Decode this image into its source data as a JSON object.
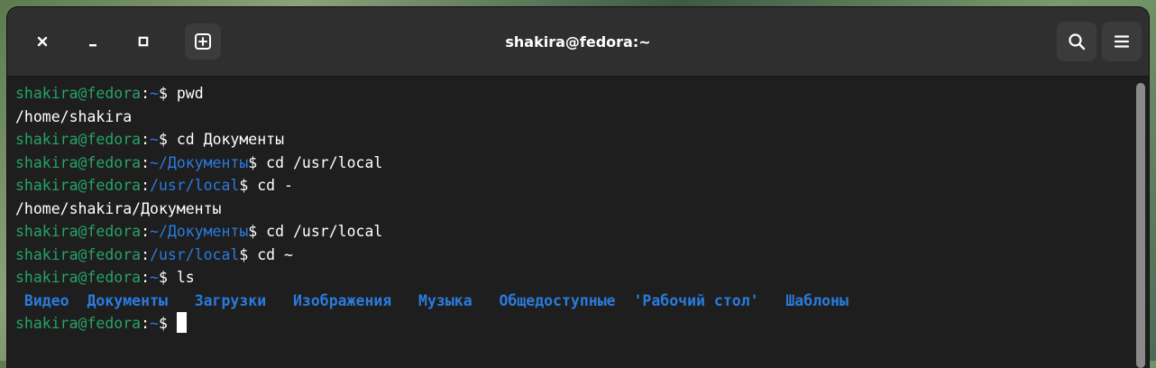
{
  "window": {
    "title": "shakira@fedora:~"
  },
  "headerbar": {
    "icons": {
      "close": "close-icon",
      "minimize": "minimize-icon",
      "maximize": "maximize-icon",
      "new_tab": "new-tab-icon",
      "search": "search-icon",
      "menu": "hamburger-menu-icon"
    }
  },
  "colors": {
    "user_host": "#26a269",
    "path": "#2a7bde",
    "directory": "#2a7bde",
    "text": "#ffffff",
    "background": "#1e1e1e",
    "headerbar": "#2f2f2f"
  },
  "terminal": {
    "lines": [
      {
        "user": "shakira@fedora",
        "sep": ":",
        "path": "~",
        "prompt": "$ ",
        "cmd": "pwd"
      },
      {
        "output": "/home/shakira"
      },
      {
        "user": "shakira@fedora",
        "sep": ":",
        "path": "~",
        "prompt": "$ ",
        "cmd": "cd Документы"
      },
      {
        "user": "shakira@fedora",
        "sep": ":",
        "path": "~/Документы",
        "prompt": "$ ",
        "cmd": "cd /usr/local"
      },
      {
        "user": "shakira@fedora",
        "sep": ":",
        "path": "/usr/local",
        "prompt": "$ ",
        "cmd": "cd -"
      },
      {
        "output": "/home/shakira/Документы"
      },
      {
        "user": "shakira@fedora",
        "sep": ":",
        "path": "~/Документы",
        "prompt": "$ ",
        "cmd": "cd /usr/local"
      },
      {
        "user": "shakira@fedora",
        "sep": ":",
        "path": "/usr/local",
        "prompt": "$ ",
        "cmd": "cd ~"
      },
      {
        "user": "shakira@fedora",
        "sep": ":",
        "path": "~",
        "prompt": "$ ",
        "cmd": "ls"
      },
      {
        "ls": [
          " Видео",
          "  Документы",
          "   Загрузки",
          "   Изображения",
          "   Музыка",
          "   Общедоступные",
          "  'Рабочий стол'",
          "   Шаблоны"
        ]
      },
      {
        "user": "shakira@fedora",
        "sep": ":",
        "path": "~",
        "prompt": "$ ",
        "cmd": "",
        "cursor": true
      }
    ]
  }
}
